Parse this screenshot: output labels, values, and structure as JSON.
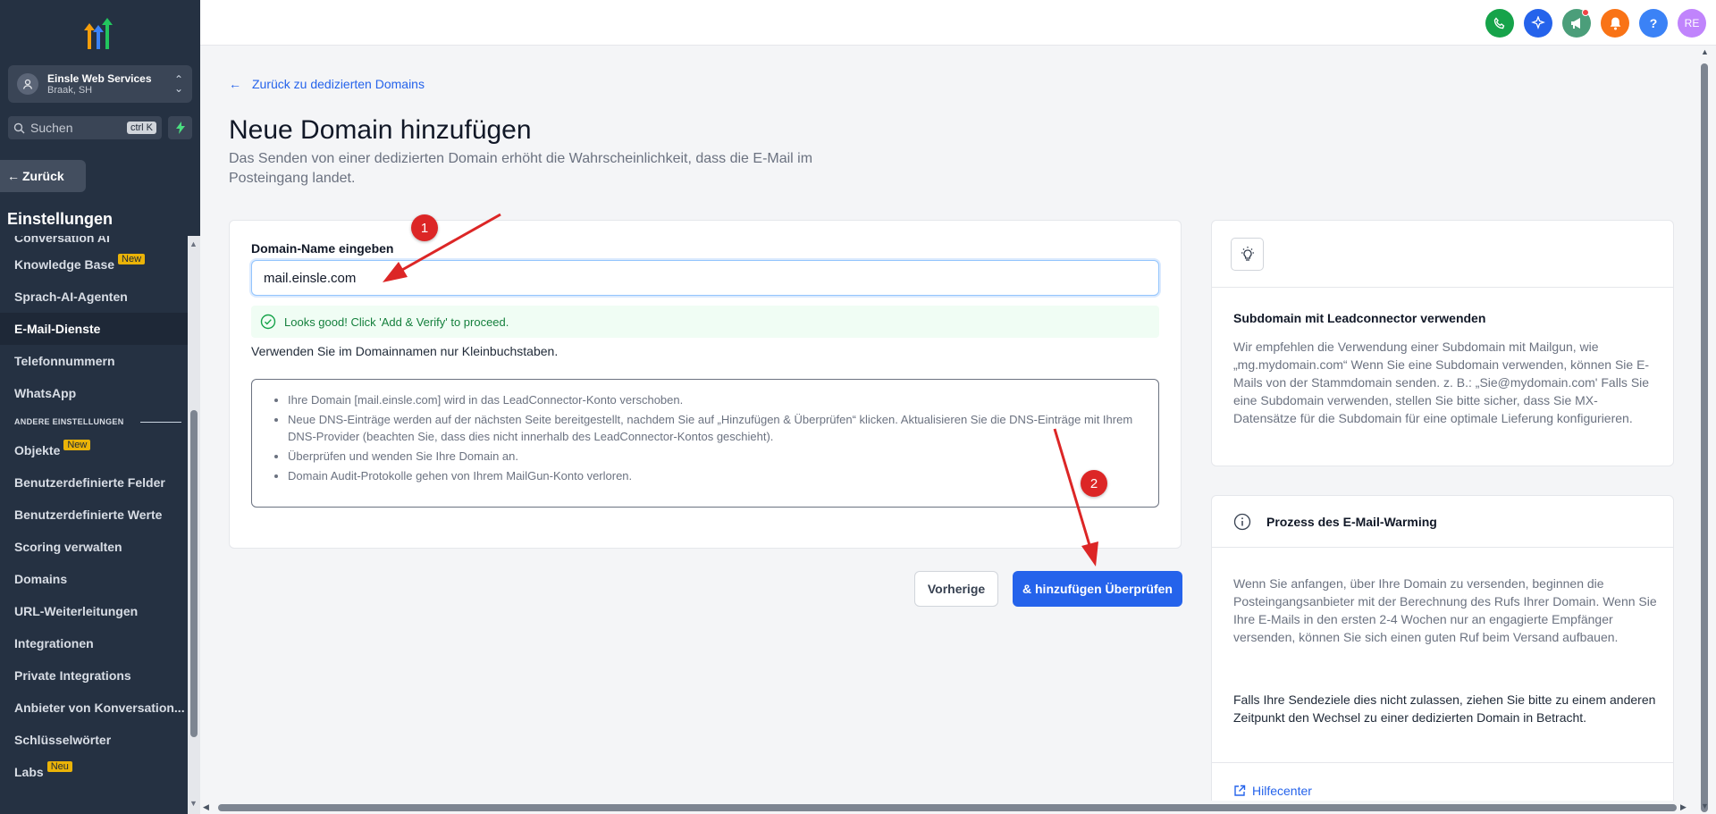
{
  "sidebar": {
    "account": {
      "name": "Einsle Web Services",
      "location": "Braak, SH"
    },
    "search": {
      "placeholder": "Suchen",
      "shortcut": "ctrl K"
    },
    "back_label": "Zurück",
    "settings_title": "Einstellungen",
    "items": [
      {
        "label": "Conversation AI",
        "badge": "",
        "active": false,
        "partial": true
      },
      {
        "label": "Knowledge Base",
        "badge": "New",
        "active": false
      },
      {
        "label": "Sprach-AI-Agenten",
        "badge": "",
        "active": false
      },
      {
        "label": "E-Mail-Dienste",
        "badge": "",
        "active": true
      },
      {
        "label": "Telefonnummern",
        "badge": "",
        "active": false
      },
      {
        "label": "WhatsApp",
        "badge": "",
        "active": false
      }
    ],
    "section_label": "ANDERE EINSTELLUNGEN",
    "items2": [
      {
        "label": "Objekte",
        "badge": "New"
      },
      {
        "label": "Benutzerdefinierte Felder",
        "badge": ""
      },
      {
        "label": "Benutzerdefinierte Werte",
        "badge": ""
      },
      {
        "label": "Scoring verwalten",
        "badge": ""
      },
      {
        "label": "Domains",
        "badge": ""
      },
      {
        "label": "URL-Weiterleitungen",
        "badge": ""
      },
      {
        "label": "Integrationen",
        "badge": ""
      },
      {
        "label": "Private Integrations",
        "badge": ""
      },
      {
        "label": "Anbieter von Konversation...",
        "badge": ""
      },
      {
        "label": "Schlüsselwörter",
        "badge": ""
      },
      {
        "label": "Labs",
        "badge": "Neu"
      }
    ]
  },
  "topbar": {
    "icons": [
      {
        "name": "phone-icon",
        "color": "#16a34a"
      },
      {
        "name": "sparkle-icon",
        "color": "#2563eb"
      },
      {
        "name": "megaphone-icon",
        "color": "#4b9e7a"
      },
      {
        "name": "bell-icon",
        "color": "#f97316"
      },
      {
        "name": "help-icon",
        "color": "#3b82f6",
        "text": "?"
      },
      {
        "name": "avatar",
        "color": "#c084fc",
        "text": "RE"
      }
    ]
  },
  "main": {
    "back_link": "Zurück zu dedizierten Domains",
    "title": "Neue Domain hinzufügen",
    "subtitle": "Das Senden von einer dedizierten Domain erhöht die Wahrscheinlichkeit, dass die E-Mail im Posteingang landet.",
    "form": {
      "label": "Domain-Name eingeben",
      "value": "mail.einsle.com",
      "success": "Looks good! Click 'Add & Verify' to proceed.",
      "hint": "Verwenden Sie im Domainnamen nur Kleinbuchstaben.",
      "bullets": [
        "Ihre Domain [mail.einsle.com] wird in das LeadConnector-Konto verschoben.",
        "Neue DNS-Einträge werden auf der nächsten Seite bereitgestellt, nachdem Sie auf „Hinzufügen & Überprüfen“ klicken. Aktualisieren Sie die DNS-Einträge mit Ihrem DNS-Provider (beachten Sie, dass dies nicht innerhalb des LeadConnector-Kontos geschieht).",
        "Überprüfen und wenden Sie Ihre Domain an.",
        "Domain Audit-Protokolle gehen von Ihrem MailGun-Konto verloren."
      ]
    },
    "buttons": {
      "prev": "Vorherige",
      "add": "& hinzufügen Überprüfen"
    },
    "tip_card": {
      "title": "Subdomain mit Leadconnector verwenden",
      "body": "Wir empfehlen die Verwendung einer Subdomain mit Mailgun, wie „mg.mydomain.com“ Wenn Sie eine Subdomain verwenden, können Sie E-Mails von der Stammdomain senden. z. B.: „Sie@mydomain.com' Falls Sie eine Subdomain verwenden, stellen Sie bitte sicher, dass Sie MX-Datensätze für die Subdomain für eine optimale Lieferung konfigurieren."
    },
    "warm_card": {
      "title": "Prozess des E-Mail-Warming",
      "body": "Wenn Sie anfangen, über Ihre Domain zu versenden, beginnen die Posteingangsanbieter mit der Berechnung des Rufs Ihrer Domain. Wenn Sie Ihre E-Mails in den ersten 2-4 Wochen nur an engagierte Empfänger versenden, können Sie sich einen guten Ruf beim Versand aufbauen.",
      "strong": "Falls Ihre Sendeziele dies nicht zulassen, ziehen Sie bitte zu einem anderen Zeitpunkt den Wechsel zu einer dedizierten Domain in Betracht.",
      "help_link": "Hilfecenter"
    }
  },
  "annotations": [
    {
      "label": "1"
    },
    {
      "label": "2"
    }
  ]
}
